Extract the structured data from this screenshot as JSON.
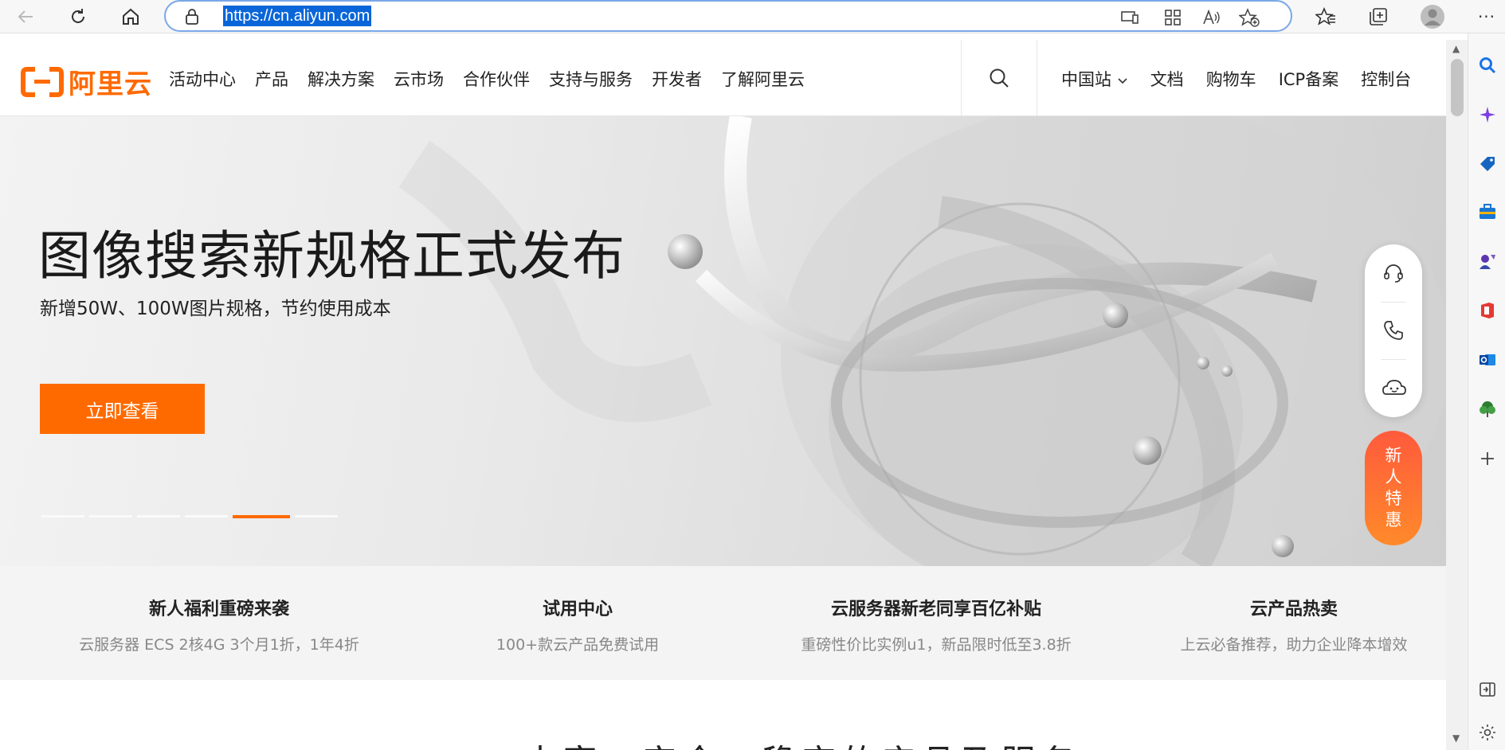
{
  "browser": {
    "url": "https://cn.aliyun.com"
  },
  "site": {
    "logo_text": "阿里云",
    "nav": [
      "活动中心",
      "产品",
      "解决方案",
      "云市场",
      "合作伙伴",
      "支持与服务",
      "开发者",
      "了解阿里云"
    ],
    "right_nav": {
      "region": "中国站",
      "docs": "文档",
      "cart": "购物车",
      "icp": "ICP备案",
      "console": "控制台"
    }
  },
  "hero": {
    "title": "图像搜索新规格正式发布",
    "subtitle": "新增50W、100W图片规格，节约使用成本",
    "button": "立即查看",
    "slide_count": 6,
    "active_slide": 5
  },
  "float": {
    "promo": [
      "新",
      "人",
      "特",
      "惠"
    ]
  },
  "info": [
    {
      "title": "新人福利重磅来袭",
      "desc": "云服务器 ECS 2核4G 3个月1折，1年4折"
    },
    {
      "title": "试用中心",
      "desc": "100+款云产品免费试用"
    },
    {
      "title": "云服务器新老同享百亿补贴",
      "desc": "重磅性价比实例u1，新品限时低至3.8折"
    },
    {
      "title": "云产品热卖",
      "desc": "上云必备推荐，助力企业降本增效"
    }
  ],
  "bottom": {
    "heading": "丰富、安全、稳定的产品及服务"
  },
  "colors": {
    "brand": "#ff6a00",
    "url_highlight": "#0a66d8"
  }
}
